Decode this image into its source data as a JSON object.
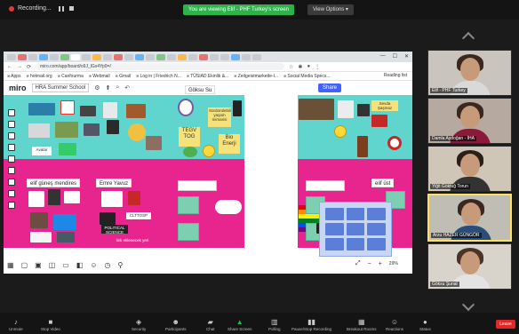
{
  "zoom": {
    "recording_label": "Recording...",
    "viewing_banner": "You are viewing Elif - PHF Turkey's screen",
    "view_options": "View Options ▾",
    "toolbar": [
      {
        "label": "Unmute",
        "icon": "mic-icon"
      },
      {
        "label": "Stop Video",
        "icon": "video-icon"
      },
      {
        "label": "Security",
        "icon": "shield-icon"
      },
      {
        "label": "Participants",
        "icon": "people-icon"
      },
      {
        "label": "Chat",
        "icon": "chat-icon"
      },
      {
        "label": "Share Screen",
        "icon": "share-screen-icon"
      },
      {
        "label": "Polling",
        "icon": "poll-icon"
      },
      {
        "label": "Pause/Stop Recording",
        "icon": "record-icon"
      },
      {
        "label": "Breakout Rooms",
        "icon": "grid-icon"
      },
      {
        "label": "Reactions",
        "icon": "smile-icon"
      },
      {
        "label": "Status",
        "icon": "info-icon"
      }
    ],
    "leave_label": "Leave"
  },
  "browser": {
    "url": "miro.com/app/board/o9J_lGx4Yp0=/",
    "bookmarks": [
      "Apps",
      "hotmail.org",
      "Canfourma",
      "Webmail",
      "Gmail",
      "Log in | Friedrich N...",
      "TÜSIAD Ekinlik &...",
      "Zeitgeistmarkette-l...",
      "Social Media Specs..."
    ],
    "reading_list": "Reading list"
  },
  "miro": {
    "logo": "miro",
    "board_name": "HRA Summer School",
    "share_label": "Share",
    "frames": {
      "goksu": "Göksu Su",
      "elif": "elif güneş mendires",
      "emre": "Emre Yavuz",
      "zeynep": "elif üst"
    },
    "stickies": {
      "tegv": "TEGV TOG",
      "bio": "Bio Enerji",
      "yellow_note": "Sürdürülebilir yaşam mimarisi",
      "pink_note": "Sevda Şaşmaz",
      "avatar_note": "Avatar",
      "teacher_note": "CLTTOSP",
      "science_note": "POLITICAL SCIENCE",
      "green_text": "link eklenecek yeri"
    },
    "zoom_level": "29%"
  },
  "participants": [
    {
      "name": "Elif - PHF Turkey",
      "shirt": "#d9d9d9"
    },
    {
      "name": "Damla Aydoğan - İHA",
      "shirt": "#8b1a3a"
    },
    {
      "name": "Yiğit Göktuğ Torun",
      "shirt": "#333333"
    },
    {
      "name": "Arzu HAZER GÜNGÖR",
      "shirt": "#2b4d7a"
    },
    {
      "name": "Göksu Şunal",
      "shirt": "#e3e3e3"
    }
  ]
}
